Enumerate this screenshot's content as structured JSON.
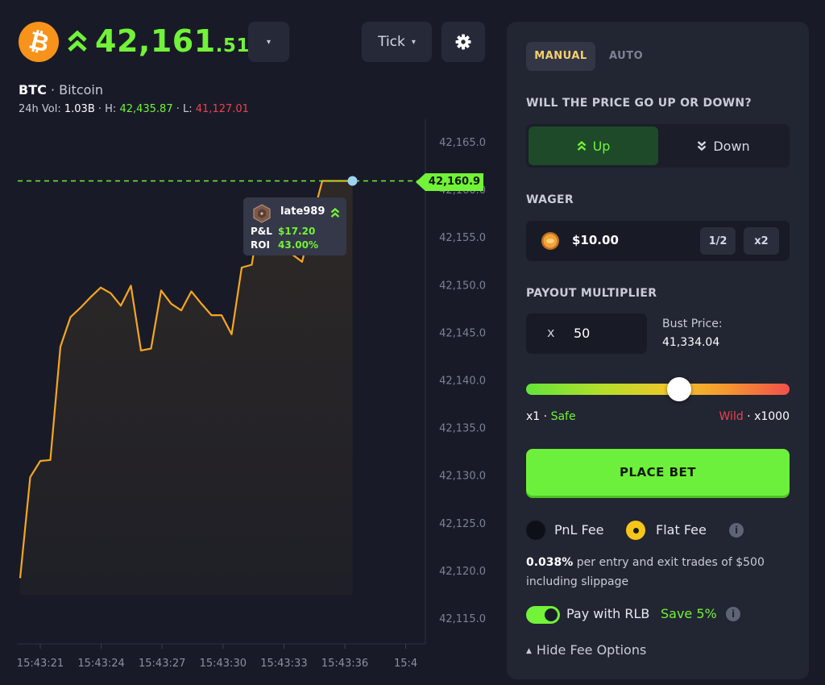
{
  "header": {
    "coin_symbol": "₿",
    "price_main": "42,161",
    "price_decimals": ".51",
    "dropdown_caret": "▾",
    "tick_label": "Tick",
    "pair_symbol": "BTC",
    "pair_sep": " · ",
    "pair_name": "Bitcoin",
    "vol_label": "24h Vol: ",
    "vol_value": "1.03B",
    "high_label": " · H: ",
    "high_value": "42,435.87",
    "low_label": " · L: ",
    "low_value": "41,127.01"
  },
  "chart_data": {
    "type": "line",
    "series": [
      {
        "x": [
          "15:43:21.0",
          "15:43:21.5",
          "15:43:22.0",
          "15:43:22.5",
          "15:43:23.0",
          "15:43:23.5",
          "15:43:24.0",
          "15:43:24.5",
          "15:43:25.0",
          "15:43:25.5",
          "15:43:26.0",
          "15:43:26.5",
          "15:43:27.0",
          "15:43:27.5",
          "15:43:28.0",
          "15:43:28.5",
          "15:43:29.0",
          "15:43:29.5",
          "15:43:30.0",
          "15:43:30.5",
          "15:43:31.0",
          "15:43:31.5",
          "15:43:32.0",
          "15:43:32.5",
          "15:43:33.0",
          "15:43:33.5",
          "15:43:34.0",
          "15:43:34.5",
          "15:43:35.0",
          "15:43:35.5",
          "15:43:36.0",
          "15:43:36.5",
          "15:43:37.0",
          "15:43:37.5"
        ],
        "values": [
          42119.2,
          42129.8,
          42131.5,
          42131.6,
          42143.5,
          42146.6,
          42147.6,
          42148.7,
          42149.7,
          42149.1,
          42147.8,
          42149.9,
          42143.1,
          42143.3,
          42149.4,
          42148.0,
          42147.3,
          42149.3,
          42148.0,
          42146.8,
          42146.8,
          42144.8,
          42151.8,
          42152.1,
          42158.6,
          42157.6,
          42157.6,
          42153.2,
          42152.4,
          42156.9,
          42160.9,
          42160.9,
          42160.9,
          42160.9
        ]
      }
    ],
    "ylim": [
      42115.0,
      42165.0
    ],
    "yticks": [
      "42,115.0",
      "42,120.0",
      "42,125.0",
      "42,130.0",
      "42,135.0",
      "42,140.0",
      "42,145.0",
      "42,150.0",
      "42,155.0",
      "42,160.0",
      "42,165.0"
    ],
    "xticks": [
      "15:43:21",
      "15:43:24",
      "15:43:27",
      "15:43:30",
      "15:43:33",
      "15:43:36",
      "15:4"
    ],
    "current_price_label": "42,160.9",
    "line_color": "#f5a623",
    "grid": false
  },
  "tooltip": {
    "username": "late989",
    "pnl_label": "P&L",
    "pnl_value": "$17.20",
    "roi_label": "ROI",
    "roi_value": "43.00%"
  },
  "panel": {
    "tab_manual": "MANUAL",
    "tab_auto": "AUTO",
    "direction_question": "WILL THE PRICE GO UP OR DOWN?",
    "up_label": "Up",
    "down_label": "Down",
    "wager_title": "WAGER",
    "wager_value": "$10.00",
    "half_label": "1/2",
    "double_label": "x2",
    "payout_title": "PAYOUT MULTIPLIER",
    "mult_prefix": "x",
    "mult_value": "50",
    "bust_label": "Bust Price:",
    "bust_value": "41,334.04",
    "range_min": "x1",
    "range_min_tag": "Safe",
    "range_max_tag": "Wild",
    "range_max": "x1000",
    "range_sep": " · ",
    "slider_level": 0.58,
    "place_bet": "PLACE BET",
    "pnl_fee": "PnL Fee",
    "flat_fee": "Flat Fee",
    "fee_desc_pct": "0.038%",
    "fee_desc_text": " per entry and exit trades of $500 including slippage",
    "pay_rlb": "Pay with RLB",
    "save_pct": "Save 5%",
    "hide_fee": "Hide Fee Options",
    "info_glyph": "i"
  },
  "colors": {
    "accent_green": "#72f238",
    "loss_red": "#f0404a",
    "flat_fee_yellow": "#f5c518",
    "bitcoin_orange": "#f7931a",
    "background": "#181b27",
    "panel": "#222532"
  }
}
